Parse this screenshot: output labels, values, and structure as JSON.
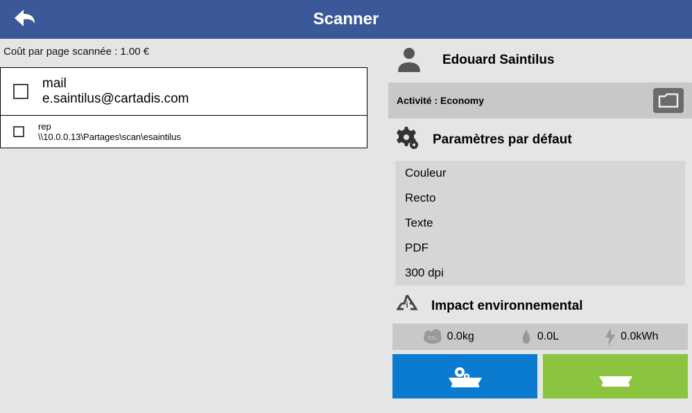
{
  "header": {
    "title": "Scanner"
  },
  "cost_line": "Coût par page scannée : 1.00 €",
  "destinations": [
    {
      "label": "mail",
      "address": "e.saintilus@cartadis.com",
      "size": "big"
    },
    {
      "label": "rep",
      "address": "\\\\10.0.0.13\\Partages\\scan\\esaintilus",
      "size": "sm"
    }
  ],
  "user": {
    "name": "Edouard Saintilus"
  },
  "activity": {
    "prefix": "Activité : ",
    "value": "Economy"
  },
  "params": {
    "title": "Paramètres par défaut",
    "items": [
      "Couleur",
      "Recto",
      "Texte",
      "PDF",
      "300 dpi"
    ]
  },
  "impact": {
    "title": "Impact environnemental",
    "co2": "0.0kg",
    "water": "0.0L",
    "energy": "0.0kWh"
  }
}
